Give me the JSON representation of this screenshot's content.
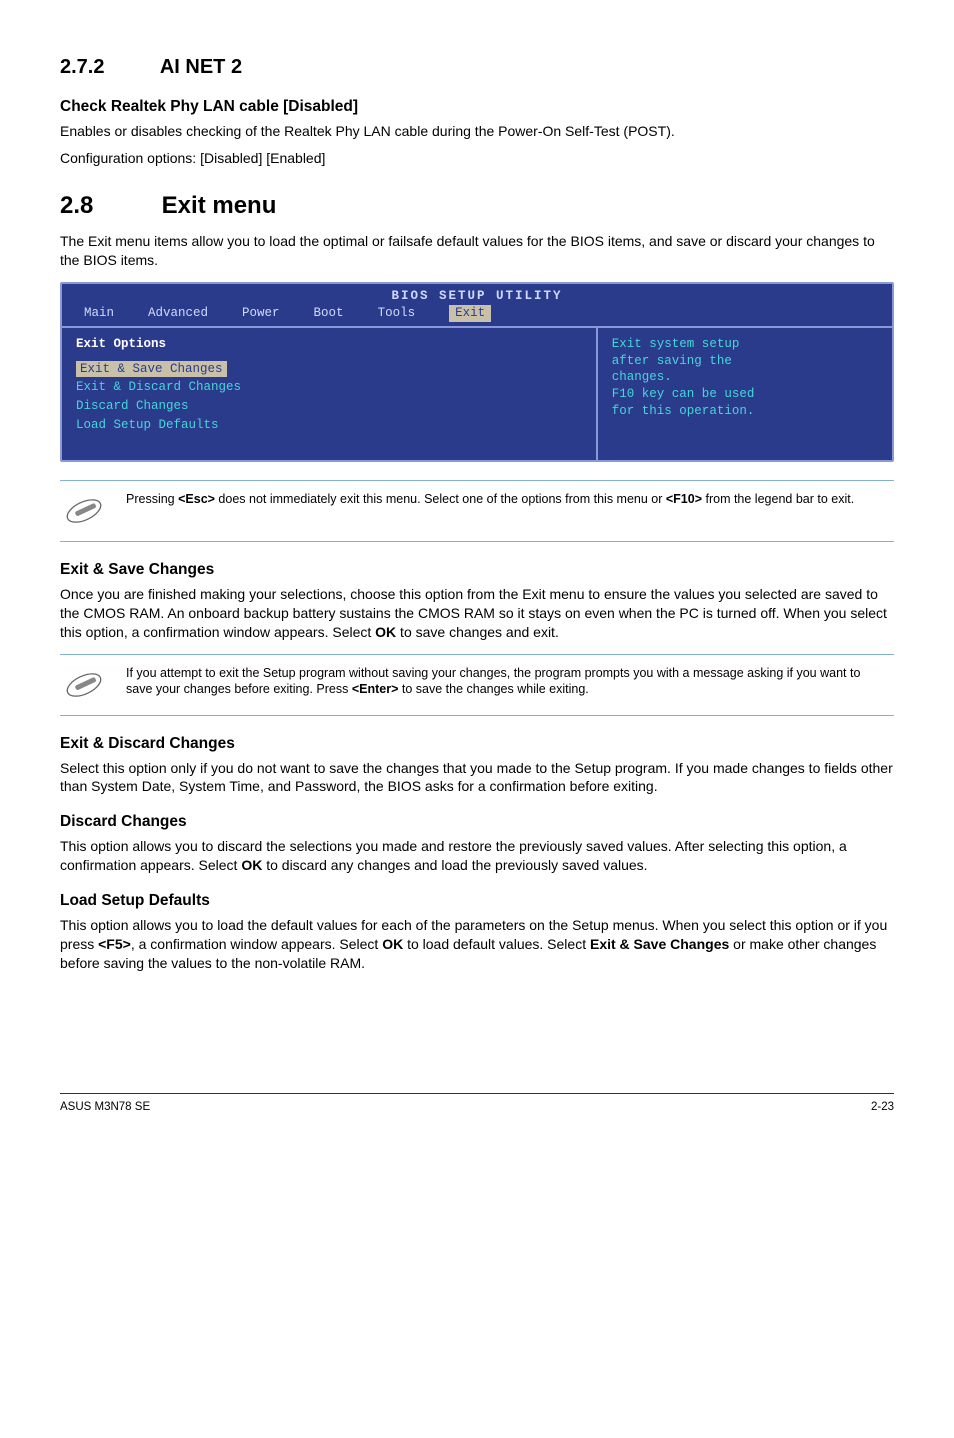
{
  "section272": {
    "heading_num": "2.7.2",
    "heading_text": "AI NET 2",
    "sub_heading": "Check Realtek Phy LAN cable [Disabled]",
    "para1": "Enables or disables checking of the Realtek Phy LAN cable during the Power-On Self-Test (POST).",
    "para2": "Configuration options: [Disabled] [Enabled]"
  },
  "section28": {
    "heading_num": "2.8",
    "heading_text": "Exit menu",
    "intro": "The Exit menu items allow you to load the optimal or failsafe default values for the BIOS items, and save or discard your changes to the BIOS items."
  },
  "bios": {
    "title": "BIOS SETUP UTILITY",
    "menu": [
      "Main",
      "Advanced",
      "Power",
      "Boot",
      "Tools",
      "Exit"
    ],
    "left_header": "Exit Options",
    "left_items": [
      "Exit & Save Changes",
      "Exit & Discard Changes",
      "Discard Changes",
      "",
      "Load Setup Defaults"
    ],
    "right_lines": [
      "Exit system setup",
      "after saving the",
      "changes.",
      "",
      "F10 key can be used",
      "for this operation."
    ]
  },
  "note1": {
    "text_a": "Pressing ",
    "key1": "<Esc>",
    "text_b": " does not immediately exit this menu. Select one of the options from this menu or ",
    "key2": "<F10>",
    "text_c": " from the legend bar to exit."
  },
  "exit_save": {
    "heading": "Exit & Save Changes",
    "body_a": "Once you are finished making your selections, choose this option from the Exit menu to ensure the values you selected are saved to the CMOS RAM. An onboard backup battery sustains the CMOS RAM so it stays on even when the PC is turned off. When you select this option, a confirmation window appears. Select ",
    "key": "OK",
    "body_b": " to save changes and exit."
  },
  "note2": {
    "text_a": " If you attempt to exit the Setup program without saving your changes, the program prompts you with a message asking if you want to save your changes before exiting. Press ",
    "key": "<Enter>",
    "text_b": " to save the  changes while exiting."
  },
  "exit_discard": {
    "heading": "Exit & Discard Changes",
    "body": "Select this option only if you do not want to save the changes that you  made to the Setup program. If you made changes to fields other than System Date, System Time, and Password, the BIOS asks for a confirmation before exiting."
  },
  "discard": {
    "heading": "Discard Changes",
    "body_a": "This option allows you to discard the selections you made and restore the previously saved values. After selecting this option, a confirmation appears. Select ",
    "key": "OK",
    "body_b": " to discard any changes and load the previously saved values."
  },
  "load_defaults": {
    "heading": "Load Setup Defaults",
    "body_a": "This option allows you to load the default values for each of the parameters on the Setup menus. When you select this option or if you press ",
    "key1": "<F5>",
    "body_b": ", a confirmation window appears. Select ",
    "key2": "OK",
    "body_c": " to load default values. Select ",
    "key3": "Exit & Save Changes",
    "body_d": " or make other changes before saving the values to the non-volatile RAM."
  },
  "footer": {
    "left": "ASUS M3N78 SE",
    "right": "2-23"
  }
}
